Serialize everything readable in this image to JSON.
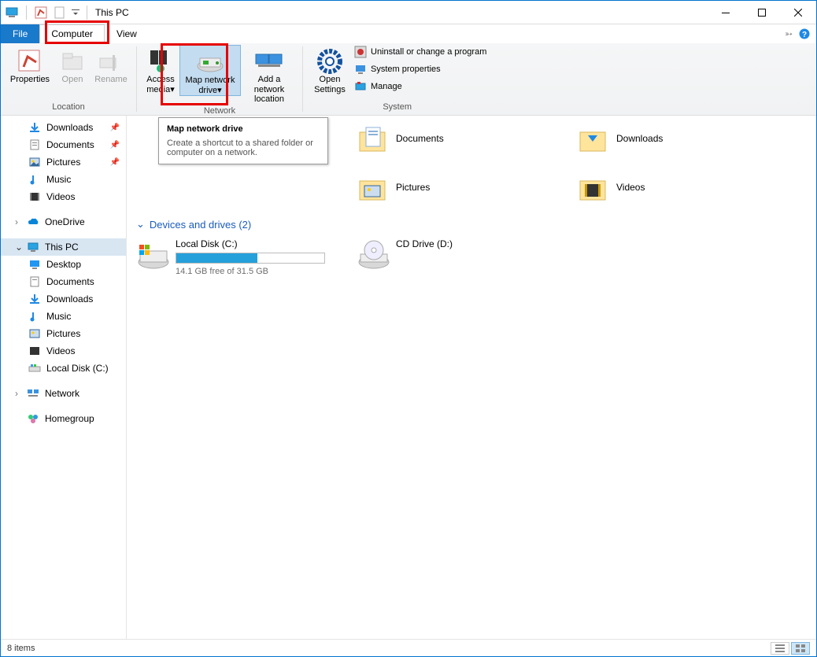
{
  "window": {
    "title": "This PC"
  },
  "tabs": {
    "file": "File",
    "computer": "Computer",
    "view": "View"
  },
  "ribbon": {
    "location": {
      "label": "Location",
      "properties": "Properties",
      "open": "Open",
      "rename": "Rename"
    },
    "network": {
      "label": "Network",
      "access_media": "Access media",
      "map_drive": "Map network drive",
      "add_location": "Add a network location"
    },
    "system": {
      "label": "System",
      "open_settings": "Open Settings",
      "uninstall": "Uninstall or change a program",
      "sysprops": "System properties",
      "manage": "Manage"
    }
  },
  "tooltip": {
    "title": "Map network drive",
    "body": "Create a shortcut to a shared folder or computer on a network."
  },
  "nav": {
    "quick": [
      {
        "label": "Downloads",
        "pinned": true
      },
      {
        "label": "Documents",
        "pinned": true
      },
      {
        "label": "Pictures",
        "pinned": true
      },
      {
        "label": "Music",
        "pinned": false
      },
      {
        "label": "Videos",
        "pinned": false
      }
    ],
    "onedrive": "OneDrive",
    "thispc": "This PC",
    "thispc_children": [
      "Desktop",
      "Documents",
      "Downloads",
      "Music",
      "Pictures",
      "Videos",
      "Local Disk (C:)"
    ],
    "network": "Network",
    "homegroup": "Homegroup"
  },
  "content": {
    "folders": [
      {
        "name": "Documents"
      },
      {
        "name": "Downloads"
      },
      {
        "name": "Pictures"
      },
      {
        "name": "Videos"
      }
    ],
    "section": "Devices and drives (2)",
    "drives": [
      {
        "name": "Local Disk (C:)",
        "free": "14.1 GB free of 31.5 GB",
        "fill_pct": 55
      },
      {
        "name": "CD Drive (D:)"
      }
    ]
  },
  "status": {
    "items": "8 items"
  }
}
